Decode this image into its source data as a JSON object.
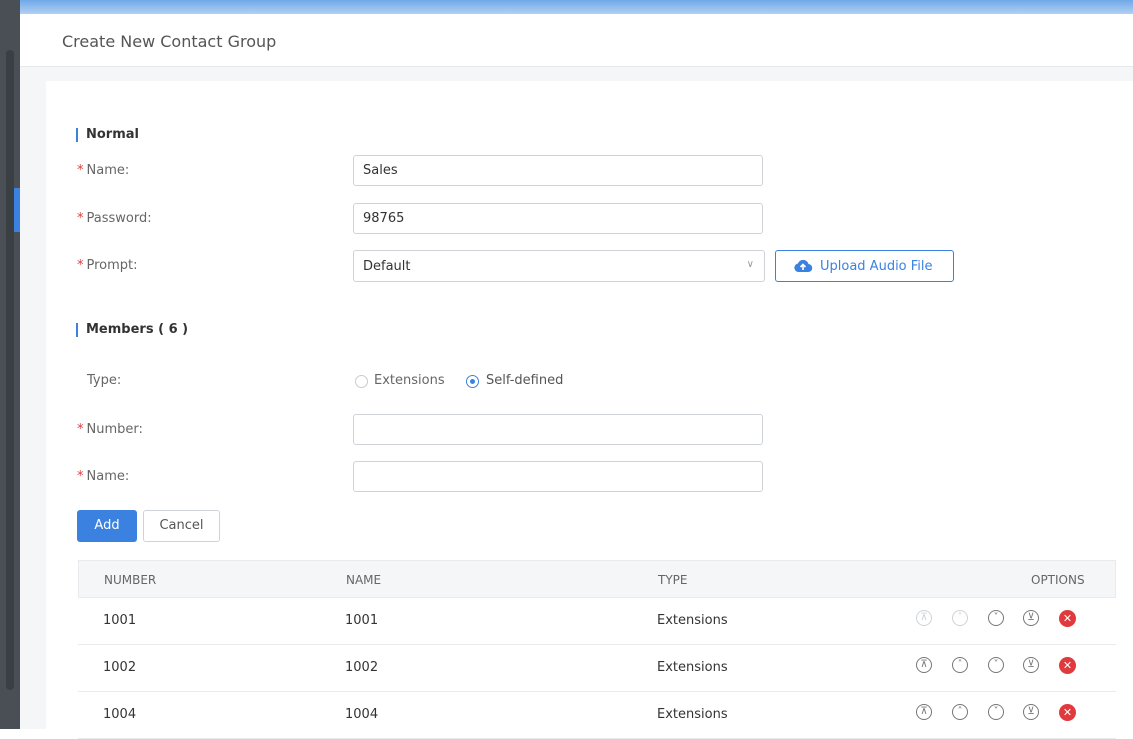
{
  "header": {
    "title": "Create New Contact Group"
  },
  "normal": {
    "section_title": "Normal",
    "name": {
      "label": "Name:",
      "value": "Sales"
    },
    "password": {
      "label": "Password:",
      "value": "98765"
    },
    "prompt": {
      "label": "Prompt:",
      "value": "Default"
    },
    "upload_label": "Upload Audio File"
  },
  "members": {
    "section_title": "Members ( 6 )",
    "type_label": "Type:",
    "type_options": [
      {
        "label": "Extensions",
        "checked": false
      },
      {
        "label": "Self-defined",
        "checked": true
      }
    ],
    "number": {
      "label": "Number:",
      "value": ""
    },
    "name": {
      "label": "Name:",
      "value": ""
    },
    "add_label": "Add",
    "cancel_label": "Cancel"
  },
  "table": {
    "headers": [
      "NUMBER",
      "NAME",
      "TYPE",
      "OPTIONS"
    ],
    "rows": [
      {
        "number": "1001",
        "name": "1001",
        "type": "Extensions"
      },
      {
        "number": "1002",
        "name": "1002",
        "type": "Extensions"
      },
      {
        "number": "1004",
        "name": "1004",
        "type": "Extensions"
      }
    ]
  },
  "icons": {
    "upload": "cloud-upload-icon",
    "move_top": "move-to-top-icon",
    "move_up": "move-up-icon",
    "move_down": "move-down-icon",
    "move_bottom": "move-to-bottom-icon",
    "delete": "delete-icon",
    "caret": "chevron-down-icon"
  },
  "colors": {
    "accent": "#3b82e0",
    "required": "#e0393e",
    "delete": "#e0393e"
  }
}
